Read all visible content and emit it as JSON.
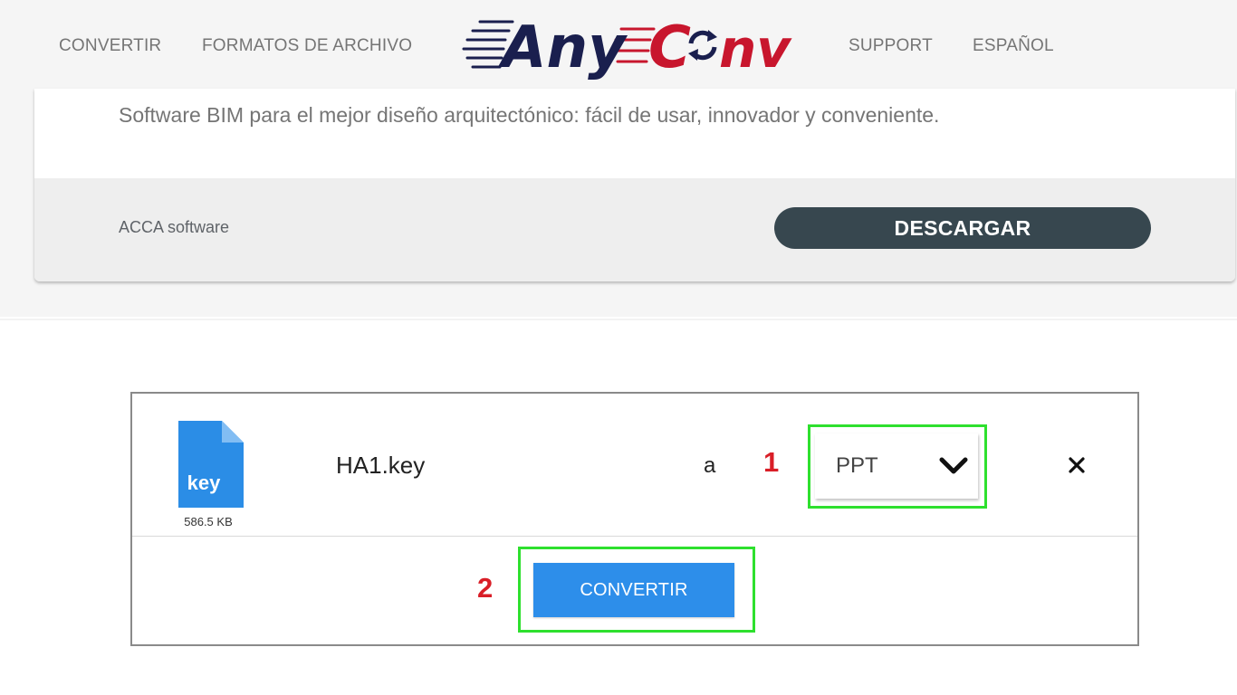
{
  "nav": {
    "convert": "CONVERTIR",
    "formats": "FORMATOS DE ARCHIVO",
    "support": "SUPPORT",
    "language": "ESPAÑOL"
  },
  "logo": {
    "part1": "Any",
    "part2": "C",
    "part3": "nv",
    "color_dark": "#1a1f4e",
    "color_red": "#c8162d"
  },
  "ad": {
    "text": "Software BIM para el mejor diseño arquitectónico: fácil de usar, innovador y conveniente.",
    "company": "ACCA software",
    "button_label": "DESCARGAR"
  },
  "converter": {
    "file_type_label": "key",
    "file_size": "586.5 KB",
    "file_name": "HA1.key",
    "to_label": "a",
    "selected_format": "PPT",
    "convert_label": "CONVERTIR",
    "close_icon": "close-icon"
  },
  "annotations": {
    "step1": "1",
    "step2": "2",
    "highlight_color": "#2ee02e",
    "number_color": "#d91e27"
  },
  "colors": {
    "file_icon": "#2b8de6",
    "convert_button": "#2d8eea",
    "ad_button": "#37474f"
  }
}
